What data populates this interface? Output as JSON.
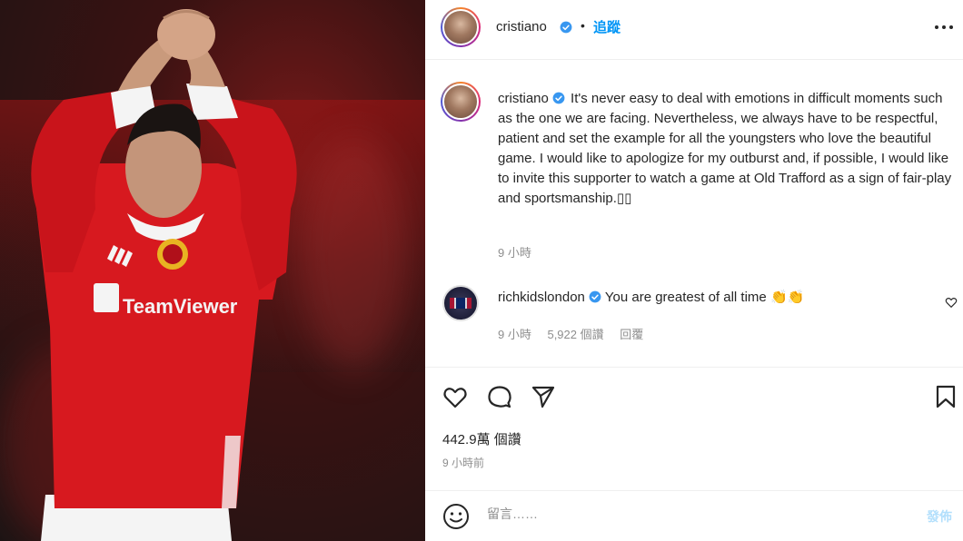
{
  "post": {
    "author": "cristiano",
    "follow_label": "追蹤",
    "dot": "•",
    "caption": "It's never easy to deal with emotions in difficult moments such as the one we are facing. Nevertheless, we always have to be respectful, patient and set the example for all the youngsters who love the beautiful game. I would like to apologize for my outburst and, if possible, I would like to invite this supporter to watch a game at Old Trafford as a sign of fair-play and sportsmanship.▯▯",
    "caption_time": "9 小時"
  },
  "comment": {
    "author": "richkidslondon",
    "text": "You are greatest of all time 👏👏",
    "time": "9 小時",
    "likes": "5,922 個讚",
    "reply_label": "回覆"
  },
  "stats": {
    "likes": "442.9萬 個讚",
    "time": "9 小時前"
  },
  "comment_bar": {
    "placeholder": "留言……",
    "post_label": "發佈"
  },
  "colors": {
    "accent": "#0095f6",
    "verified": "#3897f0",
    "jersey_red": "#d7191f",
    "text": "#262626",
    "muted": "#8e8e8e"
  },
  "icons": [
    "verified-icon",
    "more-options-icon",
    "heart-icon",
    "comment-icon",
    "share-icon",
    "bookmark-icon",
    "emoji-icon"
  ]
}
